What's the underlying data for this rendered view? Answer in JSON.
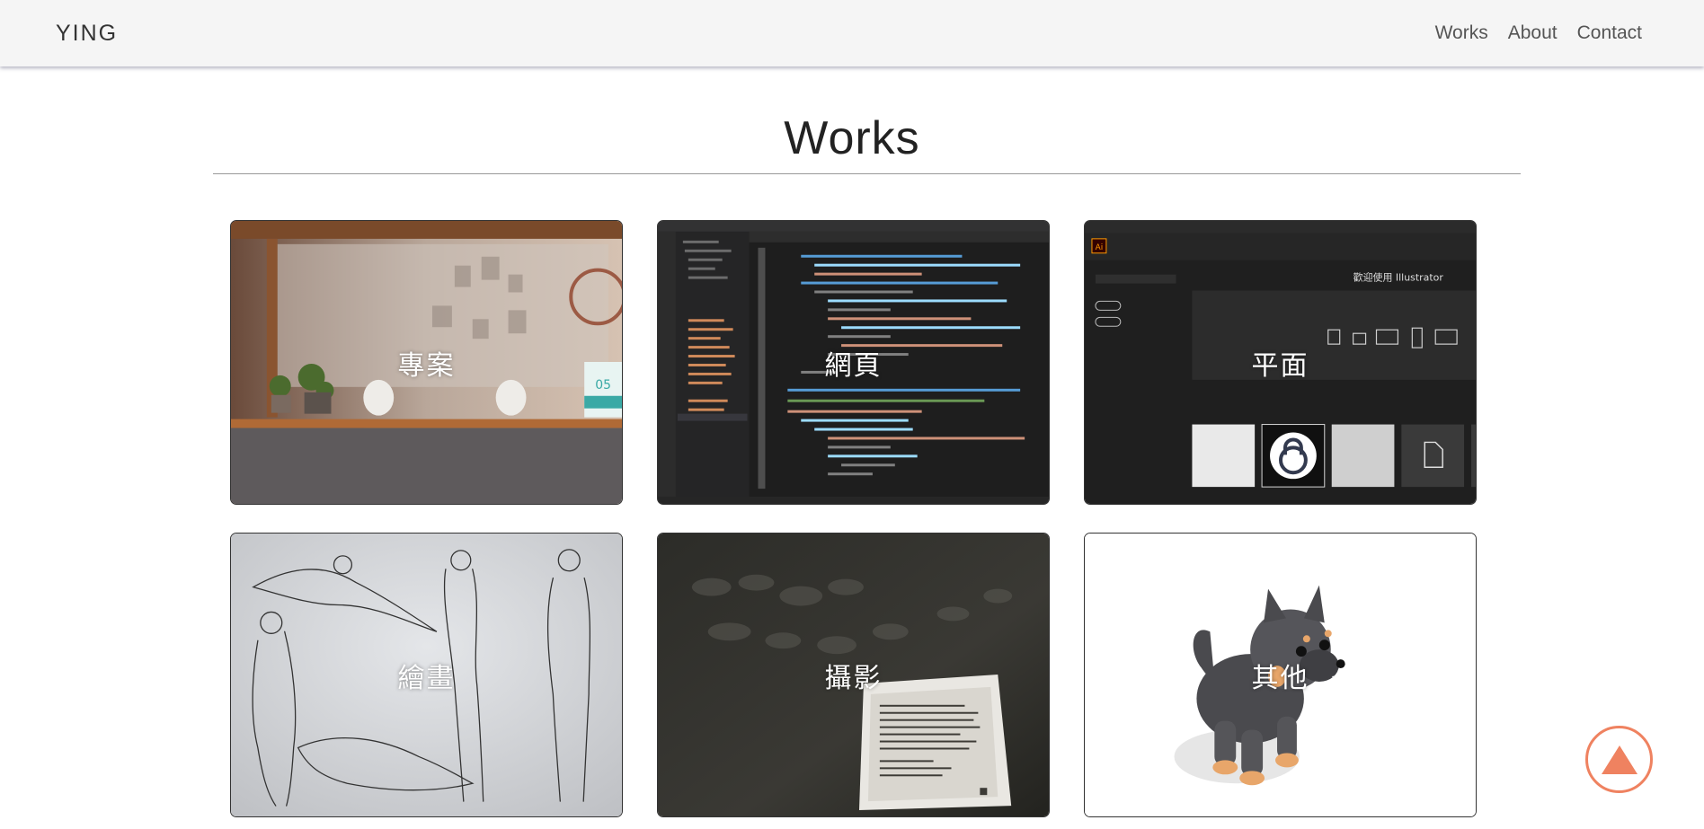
{
  "nav": {
    "brand": "YING",
    "links": [
      "Works",
      "About",
      "Contact"
    ]
  },
  "section": {
    "title": "Works"
  },
  "works": [
    {
      "label": "專案",
      "icon": "shelf-photo-image"
    },
    {
      "label": "網頁",
      "icon": "code-editor-image"
    },
    {
      "label": "平面",
      "icon": "illustrator-image"
    },
    {
      "label": "繪畫",
      "icon": "figure-sketch-image"
    },
    {
      "label": "攝影",
      "icon": "shadow-photo-image"
    },
    {
      "label": "其他",
      "icon": "dog-figure-image"
    }
  ],
  "thumb_text": {
    "calendar_day": "05",
    "ai_badge": "Ai",
    "ai_welcome": "歡迎使用 Illustrator"
  },
  "colors": {
    "accent": "#ef8260",
    "nav_bg": "#f5f5f5",
    "editor_bg": "#1e1e1e"
  }
}
